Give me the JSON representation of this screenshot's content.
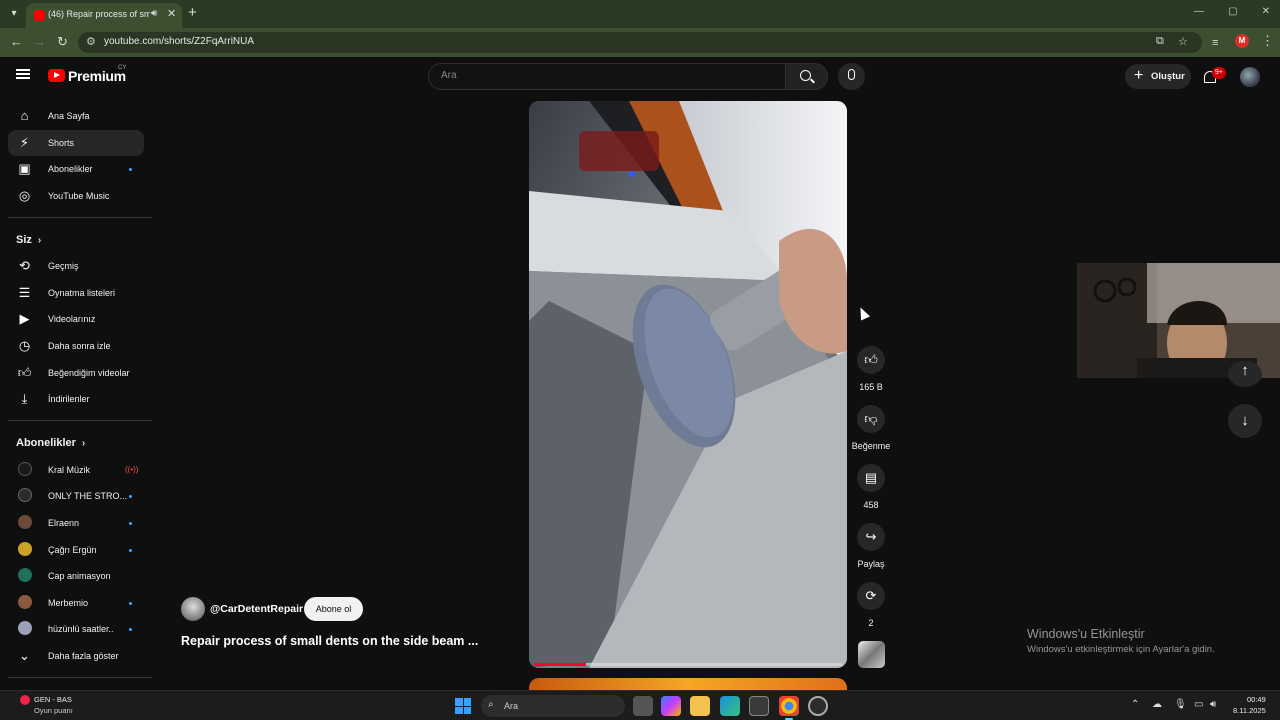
{
  "browser": {
    "tab_title": "(46) Repair process of small",
    "url": "youtube.com/shorts/Z2FqArriNUA",
    "profile_initial": "M"
  },
  "header": {
    "logo_text": "Premium",
    "country_code": "CY",
    "search_placeholder": "Ara",
    "create_label": "Oluştur",
    "notification_count": "9+"
  },
  "sidebar": {
    "main_items": [
      {
        "label": "Ana Sayfa",
        "icon": "home-icon"
      },
      {
        "label": "Shorts",
        "icon": "shorts-icon"
      },
      {
        "label": "Abonelikler",
        "icon": "subscriptions-icon"
      },
      {
        "label": "YouTube Music",
        "icon": "music-icon"
      }
    ],
    "you_title": "Siz",
    "you_items": [
      {
        "label": "Geçmiş",
        "icon": "history-icon"
      },
      {
        "label": "Oynatma listeleri",
        "icon": "playlists-icon"
      },
      {
        "label": "Videolarınız",
        "icon": "your-videos-icon"
      },
      {
        "label": "Daha sonra izle",
        "icon": "watch-later-icon"
      },
      {
        "label": "Beğendiğim videolar",
        "icon": "liked-videos-icon"
      },
      {
        "label": "İndirilenler",
        "icon": "downloads-icon"
      }
    ],
    "subscriptions_title": "Abonelikler",
    "subscriptions": [
      {
        "label": "Kral Müzik",
        "avatar_color": "#1a1a1a"
      },
      {
        "label": "ONLY THE STRO...",
        "avatar_color": "#2b2b2b"
      },
      {
        "label": "Elraenn",
        "avatar_color": "#6b4a3a"
      },
      {
        "label": "Çağrı Ergün",
        "avatar_color": "#c9a227"
      },
      {
        "label": "Cap animasyon",
        "avatar_color": "#1f6f5a"
      },
      {
        "label": "Merbemio",
        "avatar_color": "#8a5a3c"
      },
      {
        "label": "hüzünlü saatler..",
        "avatar_color": "#9aa0b5"
      }
    ],
    "show_more_label": "Daha fazla göster"
  },
  "short": {
    "channel_handle": "@CarDetentRepair",
    "subscribe_label": "Abone ol",
    "title": "Repair process of small dents on the side beam ...",
    "progress_percent": 17,
    "actions": [
      {
        "icon": "like-icon",
        "label": "165 B"
      },
      {
        "icon": "dislike-icon",
        "label": "Beğenme"
      },
      {
        "icon": "comments-icon",
        "label": "458"
      },
      {
        "icon": "share-icon",
        "label": "Paylaş"
      },
      {
        "icon": "remix-icon",
        "label": "2"
      }
    ]
  },
  "windows_watermark": {
    "title": "Windows'u Etkinleştir",
    "subtitle": "Windows'u etkinleştirmek için Ayarlar'a gidin."
  },
  "taskbar": {
    "weather_line1": "GEN - BAS",
    "weather_line2": "Oyun puanı",
    "search_label": "Ara",
    "time": "00:49",
    "date": "8.11.2025"
  }
}
